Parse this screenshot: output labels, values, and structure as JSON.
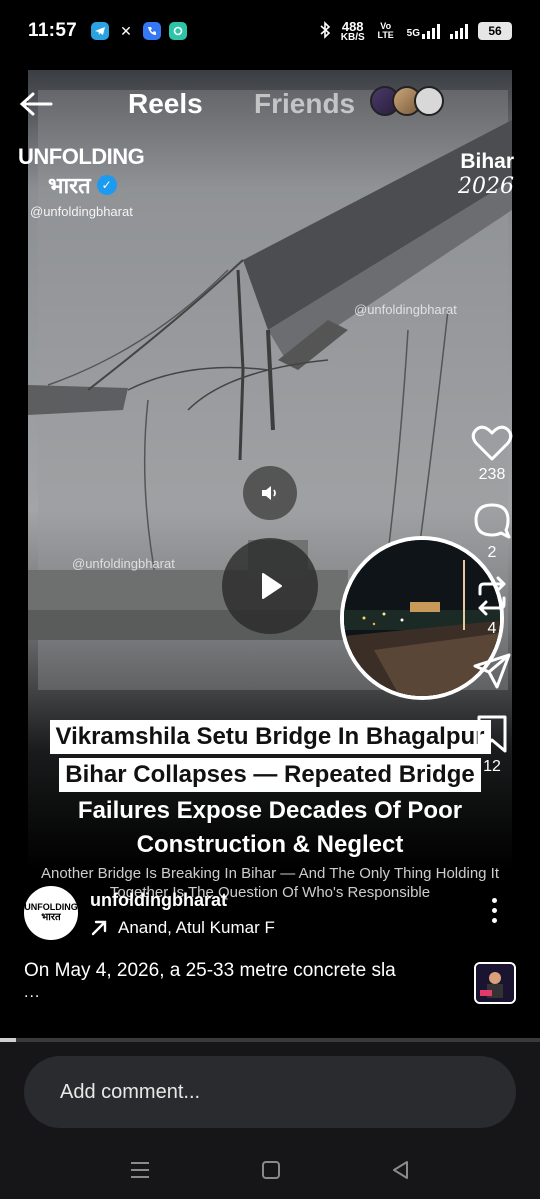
{
  "status_bar": {
    "time": "11:57",
    "net_speed": "488",
    "net_unit": "KB/S",
    "volte": "Vo LTE",
    "network": "5G",
    "battery": "56",
    "apps": [
      "telegram-icon",
      "x-icon",
      "phone-app-icon",
      "chat-app-icon"
    ]
  },
  "top_nav": {
    "tab_reels": "Reels",
    "tab_friends": "Friends"
  },
  "video": {
    "brand_line1": "UNFOLDING",
    "brand_line2": "भारत",
    "brand_handle": "@unfoldingbharat",
    "state": "Bihar",
    "year": "2026",
    "watermark": "@unfoldingbharat",
    "headline": [
      {
        "text": "Vikramshila Setu Bridge In Bhagalpur",
        "highlight": true
      },
      {
        "text": "Bihar Collapses — Repeated Bridge",
        "highlight": true
      },
      {
        "text": "Failures Expose Decades Of Poor",
        "highlight": false
      },
      {
        "text": "Construction & Neglect",
        "highlight": false
      }
    ],
    "subhead": "Another Bridge Is Breaking In Bihar — And The Only Thing Holding It Together Is The Question Of Who's Responsible"
  },
  "actions": {
    "likes": "238",
    "comments": "2",
    "reposts": "4",
    "saves": "12"
  },
  "author": {
    "name": "unfoldingbharat",
    "avatar_line1": "UNFOLDING",
    "avatar_line2": "भारत",
    "collaborators": "Anand, Atul Kumar F"
  },
  "caption": {
    "text": "On May 4, 2026, a 25-33 metre concrete sla",
    "more": "..."
  },
  "progress": {
    "fraction": 0.03
  },
  "comment_box": {
    "placeholder": "Add comment..."
  },
  "colors": {
    "accent_verified": "#1d9bf0",
    "background": "#000000",
    "comment_bg": "#2a2b2e"
  }
}
